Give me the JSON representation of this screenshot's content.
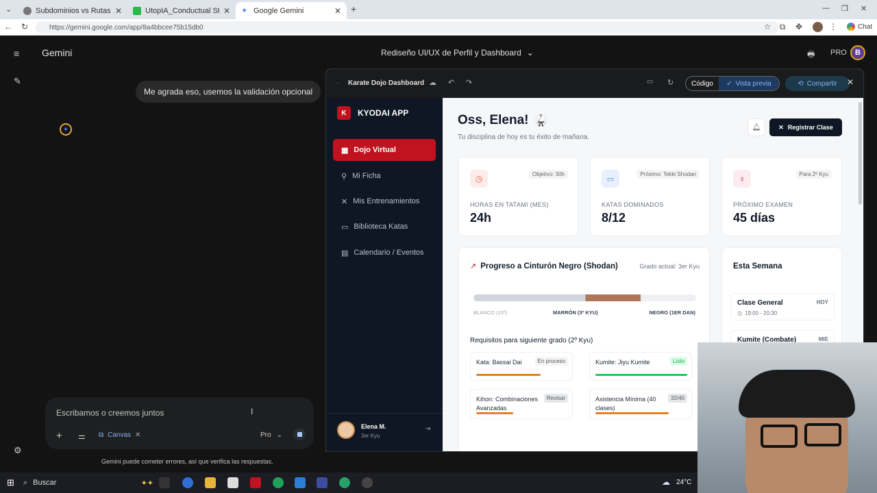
{
  "browser": {
    "tabs": [
      {
        "title": "Subdominios vs Rutas"
      },
      {
        "title": "UtopIA_Conductual Stream - Watc"
      },
      {
        "title": "Google Gemini"
      }
    ],
    "url": "https://gemini.google.com/app/8a4bbcee75b15db0",
    "chat_label": "Chat"
  },
  "gemini": {
    "brand": "Gemini",
    "conversation_title": "Rediseño UI/UX de Perfil y Dashboard",
    "pro_label": "PRO",
    "avatar_letter": "B",
    "user_message": "Me agrada eso, usemos la validación opcional",
    "input_placeholder": "Escribamos o creemos juntos",
    "canvas_chip": "Canvas",
    "model_label": "Pro",
    "disclaimer": "Gemini puede cometer errores, así que verifica las respuestas."
  },
  "canvas": {
    "title": "Karate Dojo Dashboard",
    "code_label": "Código",
    "preview_label": "Vista previa",
    "share_label": "Compartir"
  },
  "dojo": {
    "logo_letter": "K",
    "app_name": "KYODAI APP",
    "nav": [
      {
        "label": "Dojo Virtual"
      },
      {
        "label": "Mi Ficha"
      },
      {
        "label": "Mis Entrenamientos"
      },
      {
        "label": "Biblioteca Katas"
      },
      {
        "label": "Calendario / Eventos"
      }
    ],
    "user": {
      "name": "Elena M.",
      "rank": "3er Kyu"
    },
    "greeting": "Oss, Elena!",
    "subtitle": "Tu disciplina de hoy es tu éxito de mañana.",
    "register_button": "Registrar Clase",
    "stats": [
      {
        "tag": "Objetivo: 30h",
        "label": "HORAS EN TATAMI (MES)",
        "value": "24h",
        "color": "#e25b45"
      },
      {
        "tag": "Próximo: Tekki Shodan",
        "label": "KATAS DOMINADOS",
        "value": "8/12",
        "color": "#3b82f6"
      },
      {
        "tag": "Para 2º Kyu",
        "label": "PRÓXIMO EXAMEN",
        "value": "45 días",
        "color": "#c1121f"
      }
    ],
    "progress": {
      "title": "Progreso a Cinturón Negro (Shodan)",
      "current": "Grado actual: 3er Kyu",
      "start_label": "BLANCO (10º)",
      "mid_label": "MARRÓN (3º KYU)",
      "end_label": "NEGRO (1ER DAN)",
      "fill_fraction": 0.75,
      "requirements_title": "Requisitos para siguiente grado (2º Kyu)",
      "requirements": [
        {
          "name": "Kata: Bassai Dai",
          "status": "En proceso",
          "fraction": 0.7,
          "color": "#e67e22"
        },
        {
          "name": "Kumite: Jiyu Kumite",
          "status": "Listo",
          "fraction": 1.0,
          "color": "#22c55e"
        },
        {
          "name": "Kihon: Combinaciones Avanzadas",
          "status": "Revisar",
          "fraction": 0.4,
          "color": "#e67e22"
        },
        {
          "name": "Asistencia Mínima (40 clases)",
          "status": "32/40",
          "fraction": 0.8,
          "color": "#e67e22"
        }
      ]
    },
    "week": {
      "title": "Esta Semana",
      "events": [
        {
          "name": "Clase General",
          "time": "19:00 - 20:30",
          "day": "HOY"
        },
        {
          "name": "Kumite (Combate)",
          "time": "",
          "day": "MIE"
        }
      ]
    }
  },
  "taskbar": {
    "search_label": "Buscar",
    "temperature": "24°C"
  }
}
